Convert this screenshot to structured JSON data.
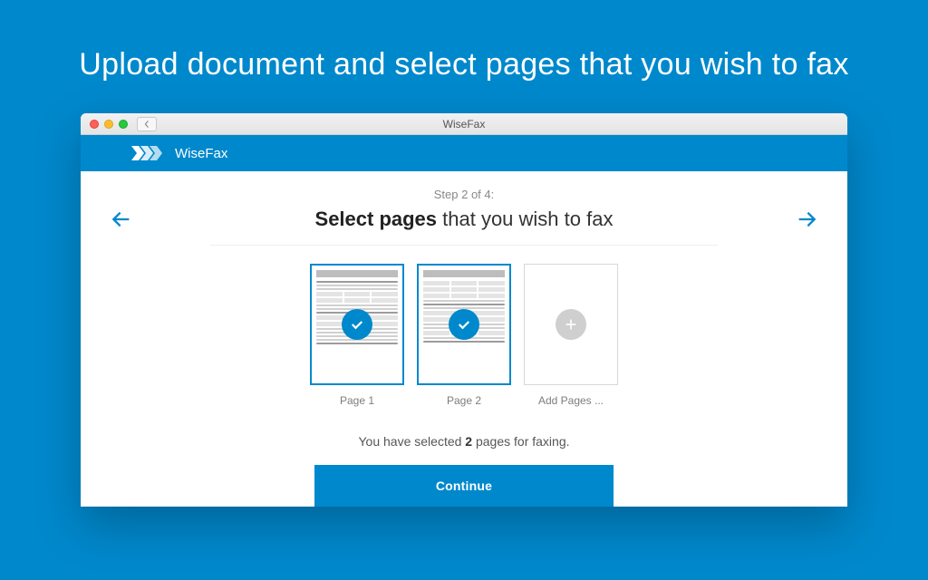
{
  "banner": {
    "title": "Upload document and select pages that you wish to fax"
  },
  "window": {
    "title": "WiseFax"
  },
  "brand": {
    "name": "WiseFax"
  },
  "step": {
    "line": "Step 2 of 4:"
  },
  "heading": {
    "bold": "Select pages",
    "rest": " that you wish to fax"
  },
  "thumbs": {
    "page1": "Page 1",
    "page2": "Page 2",
    "add": "Add Pages ..."
  },
  "status": {
    "prefix": "You have selected ",
    "count": "2",
    "suffix": " pages for faxing."
  },
  "cta": {
    "label": "Continue"
  }
}
